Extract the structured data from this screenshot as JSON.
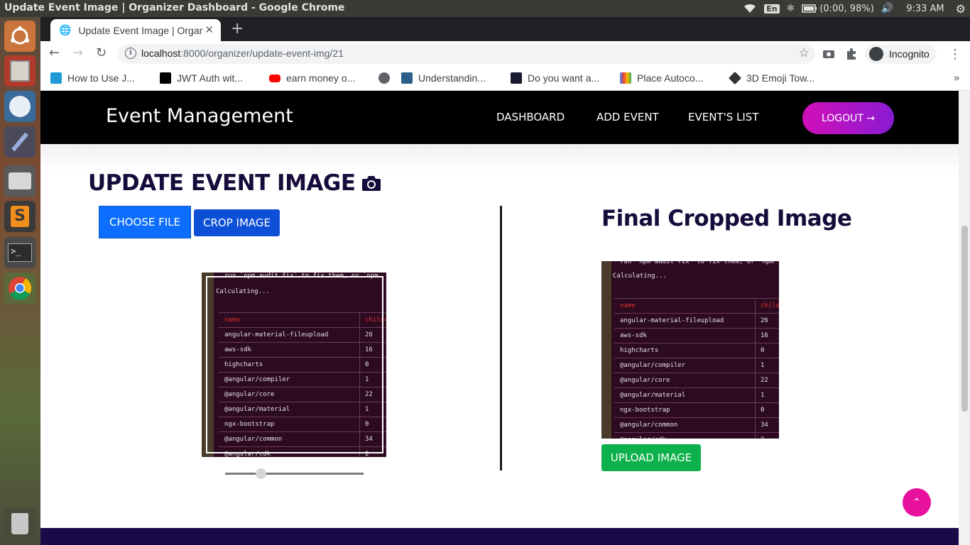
{
  "os": {
    "window_title": "Update Event Image | Organizer Dashboard - Google Chrome",
    "keyboard_layout": "En",
    "battery": "(0:00, 98%)",
    "clock": "9:33 AM"
  },
  "browser": {
    "tab_title": "Update Event Image | Organizer Dashboard",
    "url_host": "localhost",
    "url_rest": ":8000/organizer/update-event-img/21",
    "incognito_label": "Incognito",
    "bookmarks": [
      {
        "label": "How to Use J...",
        "color": "#1e9bd7"
      },
      {
        "label": "JWT Auth wit...",
        "color": "#000000"
      },
      {
        "label": "earn money o...",
        "color": "#ff0000"
      },
      {
        "label": "",
        "color": "#5f6368"
      },
      {
        "label": "Understandin...",
        "color": "#2b5f8a"
      },
      {
        "label": "Do you want a...",
        "color": "#1a1a2e"
      },
      {
        "label": "Place Autoco...",
        "color": "#4285f4"
      },
      {
        "label": "3D Emoji Tow...",
        "color": "#333333"
      }
    ]
  },
  "nav": {
    "brand": "Event Management",
    "links": [
      "DASHBOARD",
      "ADD EVENT",
      "EVENT'S LIST"
    ],
    "logout": "LOGOUT →"
  },
  "main": {
    "heading": "UPDATE EVENT IMAGE",
    "choose_file": "CHOOSE FILE",
    "crop_image": "CROP IMAGE",
    "final_heading": "Final Cropped Image",
    "upload_image": "UPLOAD IMAGE",
    "zoom_level": 0.26
  },
  "terminal": {
    "top_line": "run `npm audit fix` to fix them, or `npm",
    "calculating": "Calculating...",
    "col_name": "name",
    "col_children": "children",
    "rows": [
      [
        "angular-material-fileupload",
        "26"
      ],
      [
        "aws-sdk",
        "16"
      ],
      [
        "highcharts",
        "0"
      ],
      [
        "@angular/compiler",
        "1"
      ],
      [
        "@angular/core",
        "22"
      ],
      [
        "@angular/material",
        "1"
      ],
      [
        "ngx-bootstrap",
        "0"
      ],
      [
        "@angular/common",
        "34"
      ],
      [
        "@angular/cdk",
        "2"
      ]
    ]
  },
  "colors": {
    "brand_heading": "#160b3a",
    "primary": "#0d6efd",
    "success": "#0db14b",
    "accent_pink": "#e8119e",
    "footer": "#1b0a4a"
  }
}
